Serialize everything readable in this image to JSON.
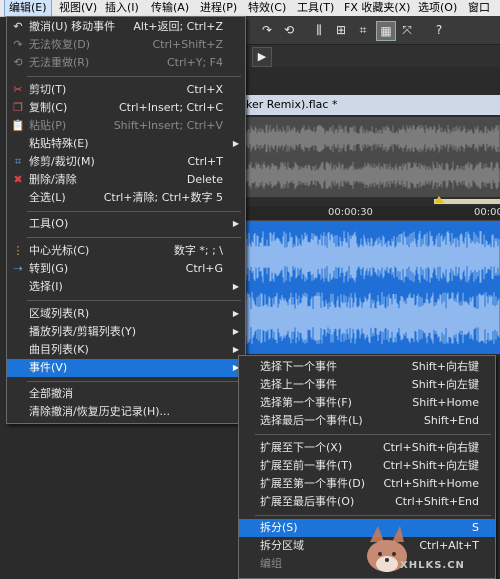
{
  "menubar": [
    {
      "label": "编辑(E)",
      "active": true
    },
    {
      "label": "视图(V)"
    },
    {
      "label": "插入(I)"
    },
    {
      "label": "传输(A)"
    },
    {
      "label": "进程(P)"
    },
    {
      "label": "特效(C)"
    },
    {
      "label": "工具(T)"
    },
    {
      "label": "FX 收藏夹(X)"
    },
    {
      "label": "选项(O)"
    },
    {
      "label": "窗口"
    }
  ],
  "edit_menu": {
    "items": [
      {
        "label": "撤消(U) 移动事件",
        "shortcut": "Alt+返回; Ctrl+Z",
        "icon": "undo-icon",
        "glyph": "↶"
      },
      {
        "label": "无法恢复(D)",
        "shortcut": "Ctrl+Shift+Z",
        "disabled": true,
        "icon": "redo-icon",
        "glyph": "↷"
      },
      {
        "label": "无法重做(R)",
        "shortcut": "Ctrl+Y; F4",
        "disabled": true,
        "icon": "repeat-icon",
        "glyph": "⟲"
      },
      {
        "label": "剪切(T)",
        "shortcut": "Ctrl+X",
        "icon": "scissors-icon",
        "glyph": "✂"
      },
      {
        "label": "复制(C)",
        "shortcut": "Ctrl+Insert; Ctrl+C",
        "icon": "copy-icon",
        "glyph": "❐"
      },
      {
        "label": "粘贴(P)",
        "shortcut": "Shift+Insert; Ctrl+V",
        "disabled": true,
        "icon": "paste-icon",
        "glyph": "📋"
      },
      {
        "label": "粘贴特殊(E)",
        "submenu": true
      },
      {
        "label": "修剪/裁切(M)",
        "shortcut": "Ctrl+T",
        "icon": "crop-icon",
        "glyph": "⌗"
      },
      {
        "label": "删除/清除",
        "shortcut": "Delete",
        "icon": "delete-icon",
        "glyph": "✖"
      },
      {
        "label": "全选(L)",
        "shortcut": "Ctrl+清除; Ctrl+数字 5"
      },
      {
        "label": "工具(O)",
        "submenu": true
      },
      {
        "label": "中心光标(C)",
        "shortcut": "数字 *; ; \\",
        "icon": "center-cursor-icon",
        "glyph": "⋮"
      },
      {
        "label": "转到(G)",
        "shortcut": "Ctrl+G",
        "icon": "goto-icon",
        "glyph": "⇢"
      },
      {
        "label": "选择(I)",
        "submenu": true
      },
      {
        "label": "区域列表(R)",
        "submenu": true
      },
      {
        "label": "播放列表/剪辑列表(Y)",
        "submenu": true
      },
      {
        "label": "曲目列表(K)",
        "submenu": true
      },
      {
        "label": "事件(V)",
        "submenu": true,
        "highlight": true
      },
      {
        "label": "全部撤消"
      },
      {
        "label": "清除撤消/恢复历史记录(H)..."
      }
    ]
  },
  "event_submenu": {
    "items": [
      {
        "label": "选择下一个事件",
        "shortcut": "Shift+向右键"
      },
      {
        "label": "选择上一个事件",
        "shortcut": "Shift+向左键"
      },
      {
        "label": "选择第一个事件(F)",
        "shortcut": "Shift+Home"
      },
      {
        "label": "选择最后一个事件(L)",
        "shortcut": "Shift+End"
      },
      {
        "label": "扩展至下一个(X)",
        "shortcut": "Ctrl+Shift+向右键"
      },
      {
        "label": "扩展至前一事件(T)",
        "shortcut": "Ctrl+Shift+向左键"
      },
      {
        "label": "扩展至第一个事件(D)",
        "shortcut": "Ctrl+Shift+Home"
      },
      {
        "label": "扩展至最后事件(O)",
        "shortcut": "Ctrl+Shift+End"
      },
      {
        "label": "拆分(S)",
        "shortcut": "S",
        "highlight": true
      },
      {
        "label": "拆分区域",
        "shortcut": "Ctrl+Alt+T"
      },
      {
        "label": "编组",
        "disabled": true
      }
    ]
  },
  "file_title": "ker Remix).flac *",
  "ruler": {
    "label_1": "00:00:30",
    "label_2": "00:00"
  },
  "watermark": {
    "text": "XHLKS.CN"
  },
  "colors": {
    "highlight": "#1c74d8",
    "waveform": "#1f6fd6",
    "menu_bg": "#2f2f2f"
  }
}
